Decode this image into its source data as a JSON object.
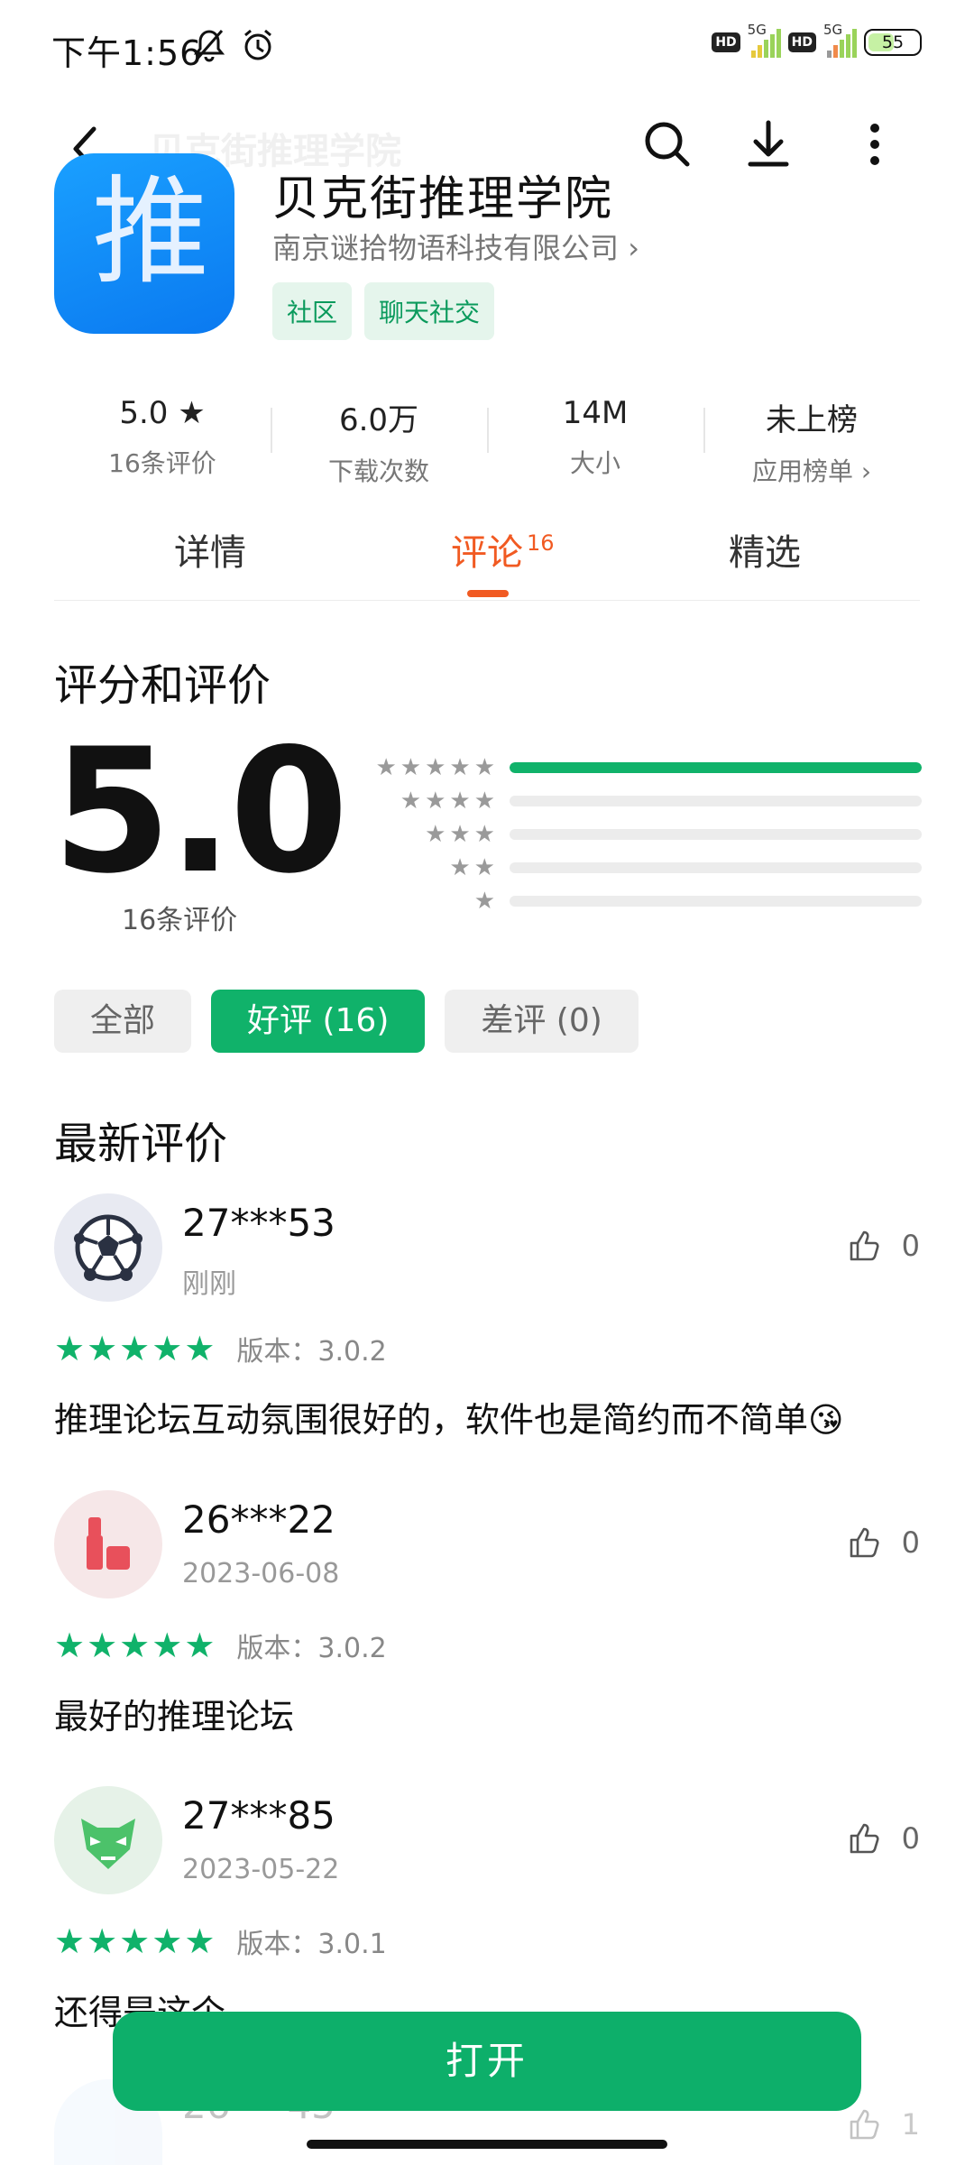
{
  "status_bar": {
    "time": "下午1:56",
    "hd1": "HD",
    "net1": "5G",
    "hd2": "HD",
    "net2": "5G",
    "battery": "55"
  },
  "header": {
    "ghost_title": "贝克街推理学院",
    "icon_char": "推",
    "app_name": "贝克街推理学院",
    "developer": "南京谜拾物语科技有限公司",
    "tags": [
      "社区",
      "聊天社交"
    ]
  },
  "stats": [
    {
      "value": "5.0 ★",
      "label": "16条评价"
    },
    {
      "value": "6.0万",
      "label": "下载次数"
    },
    {
      "value": "14M",
      "label": "大小"
    },
    {
      "value": "未上榜",
      "label": "应用榜单 ›"
    }
  ],
  "tabs": {
    "details": "详情",
    "reviews": "评论",
    "reviews_count": "16",
    "featured": "精选"
  },
  "rating": {
    "title": "评分和评价",
    "score": "5.0",
    "count_label": "16条评价",
    "distribution": [
      {
        "stars": 5,
        "fraction": 1.0
      },
      {
        "stars": 4,
        "fraction": 0
      },
      {
        "stars": 3,
        "fraction": 0
      },
      {
        "stars": 2,
        "fraction": 0
      },
      {
        "stars": 1,
        "fraction": 0
      }
    ]
  },
  "filters": {
    "all": "全部",
    "positive": "好评 (16)",
    "negative": "差评 (0)"
  },
  "latest": {
    "title": "最新评价",
    "reviews": [
      {
        "user": "27***53",
        "date": "刚刚",
        "likes": "0",
        "version": "版本：3.0.2",
        "text": "推理论坛互动氛围很好的，软件也是简约而不简单😘",
        "avatar": "soccer-ball"
      },
      {
        "user": "26***22",
        "date": "2023-06-08",
        "likes": "0",
        "version": "版本：3.0.2",
        "text": "最好的推理论坛",
        "avatar": "lipstick"
      },
      {
        "user": "27***85",
        "date": "2023-05-22",
        "likes": "0",
        "version": "版本：3.0.1",
        "text": "还得是这个",
        "avatar": "green-mask"
      }
    ],
    "partial": {
      "user": "26***45",
      "likes": "1"
    }
  },
  "open_button": "打开"
}
